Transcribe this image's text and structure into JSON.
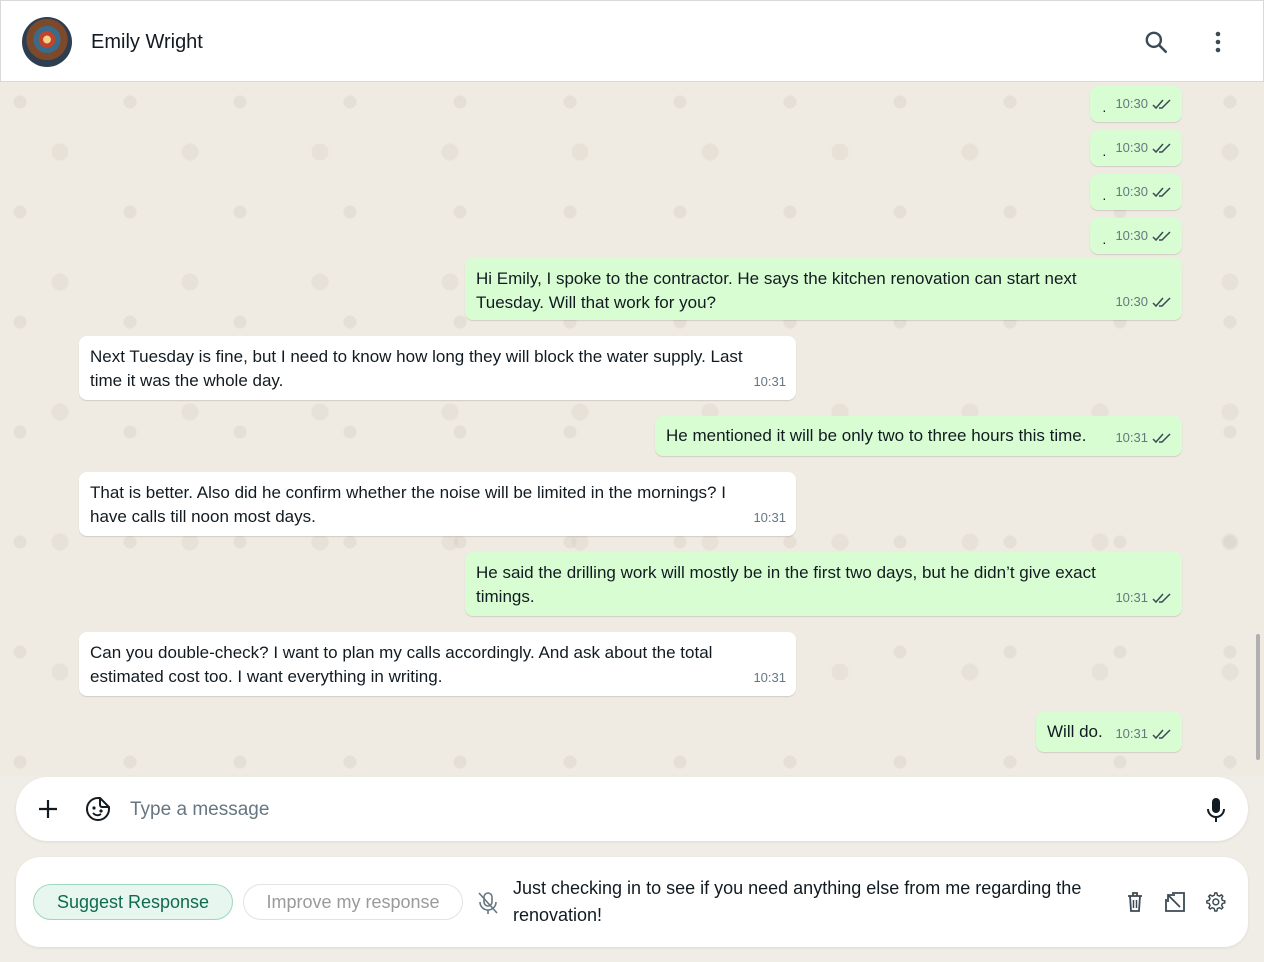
{
  "header": {
    "contact_name": "Emily Wright",
    "search_icon": "search-icon",
    "menu_icon": "more-vertical-icon"
  },
  "messages": [
    {
      "direction": "out",
      "text": "·",
      "time": "10:30",
      "status": "read"
    },
    {
      "direction": "out",
      "text": "·",
      "time": "10:30",
      "status": "read"
    },
    {
      "direction": "out",
      "text": "·",
      "time": "10:30",
      "status": "read"
    },
    {
      "direction": "out",
      "text": "·",
      "time": "10:30",
      "status": "read"
    },
    {
      "direction": "out",
      "text": "Hi Emily, I spoke to the contractor. He says the kitchen renovation can start next Tuesday. Will that work for you?",
      "time": "10:30",
      "status": "read"
    },
    {
      "direction": "in",
      "text": "Next Tuesday is fine, but I need to know how long they will block the water supply. Last time it was the whole day.",
      "time": "10:31"
    },
    {
      "direction": "out",
      "text": "He mentioned it will be only two to three hours this time.",
      "time": "10:31",
      "status": "read"
    },
    {
      "direction": "in",
      "text": "That is better. Also did he confirm whether the noise will be limited in the mornings? I have calls till noon most days.",
      "time": "10:31"
    },
    {
      "direction": "out",
      "text": "He said the drilling work will mostly be in the first two days, but he didn’t give exact timings.",
      "time": "10:31",
      "status": "read"
    },
    {
      "direction": "in",
      "text": "Can you double-check? I want to plan my calls accordingly. And ask about the total estimated cost too. I want everything in writing.",
      "time": "10:31"
    },
    {
      "direction": "out",
      "text": "Will do.",
      "time": "10:31",
      "status": "read"
    }
  ],
  "composer": {
    "placeholder": "Type a message",
    "value": ""
  },
  "assistant": {
    "suggest_label": "Suggest Response",
    "improve_label": "Improve my response",
    "draft_text": "Just checking in to see if you need anything else from me regarding the renovation!"
  },
  "colors": {
    "outgoing_bubble": "#d9fdd3",
    "incoming_bubble": "#ffffff",
    "chat_background": "#efeae2",
    "accent": "#0f6b4f"
  }
}
